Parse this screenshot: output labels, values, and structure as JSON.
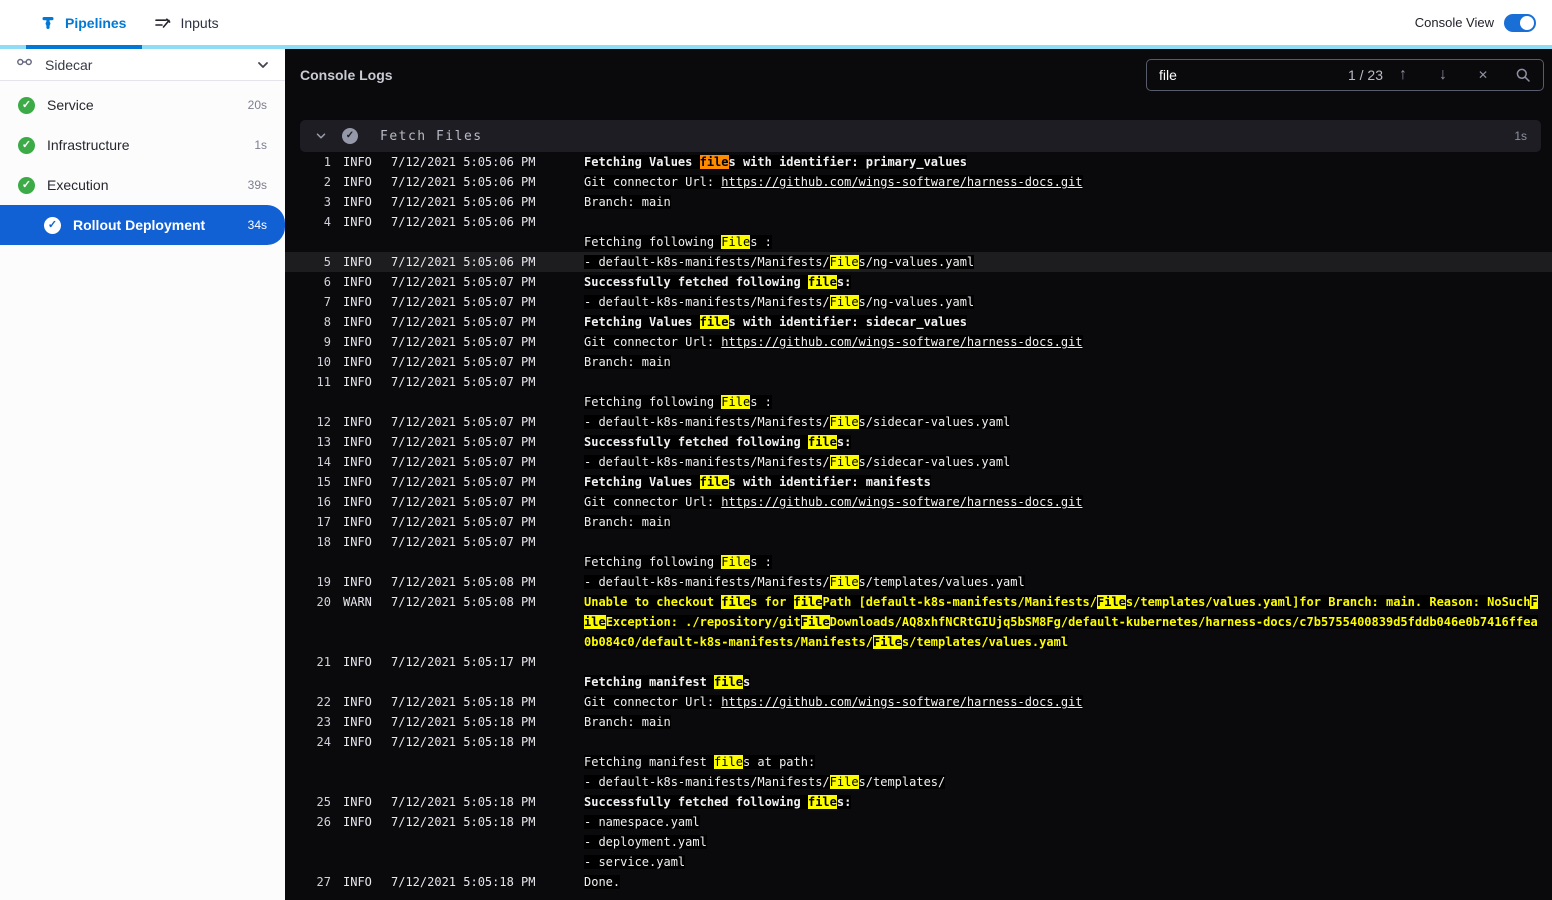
{
  "header": {
    "tabs": [
      {
        "label": "Pipelines",
        "active": true
      },
      {
        "label": "Inputs",
        "active": false
      }
    ],
    "console_view_label": "Console View",
    "console_view_on": true
  },
  "colors": {
    "accent_blue": "#0278d5",
    "selected_blue": "#1160d4",
    "underbar_cyan": "#8edcf5",
    "success_green": "#3cab47",
    "console_bg": "#0a0a0c",
    "match_current": "#ff8a00",
    "match_other": "#fcfc00",
    "warn_text": "#fcfc00"
  },
  "sidebar": {
    "title": "Sidecar",
    "items": [
      {
        "label": "Service",
        "duration": "20s",
        "status": "success",
        "selected": false
      },
      {
        "label": "Infrastructure",
        "duration": "1s",
        "status": "success",
        "selected": false
      },
      {
        "label": "Execution",
        "duration": "39s",
        "status": "success",
        "selected": false
      },
      {
        "label": "Rollout Deployment",
        "duration": "34s",
        "status": "success",
        "selected": true
      }
    ]
  },
  "console": {
    "title": "Console Logs",
    "search": {
      "value": "file",
      "count": "1 / 23"
    },
    "section": {
      "title": "Fetch Files",
      "duration": "1s"
    },
    "rows": [
      {
        "n": "1",
        "lv": "INFO",
        "t": "7/12/2021 5:05:06 PM",
        "b": 1,
        "s": [
          {
            "t": "Fetching Values "
          },
          {
            "t": "file",
            "h": "o"
          },
          {
            "t": "s with identifier: primary_values"
          }
        ]
      },
      {
        "n": "2",
        "lv": "INFO",
        "t": "7/12/2021 5:05:06 PM",
        "s": [
          {
            "t": "Git connector Url: "
          },
          {
            "t": "https://github.com/wings-software/harness-docs.git",
            "u": 1
          }
        ]
      },
      {
        "n": "3",
        "lv": "INFO",
        "t": "7/12/2021 5:05:06 PM",
        "s": [
          {
            "t": "Branch: main"
          }
        ]
      },
      {
        "n": "4",
        "lv": "INFO",
        "t": "7/12/2021 5:05:06 PM",
        "s": []
      },
      {
        "n": "",
        "lv": "",
        "t": "",
        "s": [
          {
            "t": "Fetching following "
          },
          {
            "t": "File",
            "h": "y"
          },
          {
            "t": "s :"
          }
        ]
      },
      {
        "n": "5",
        "lv": "INFO",
        "t": "7/12/2021 5:05:06 PM",
        "hl": 1,
        "s": [
          {
            "t": "- default-k8s-manifests/Manifests/"
          },
          {
            "t": "File",
            "h": "y"
          },
          {
            "t": "s/ng-values.yaml"
          }
        ]
      },
      {
        "n": "6",
        "lv": "INFO",
        "t": "7/12/2021 5:05:07 PM",
        "b": 1,
        "s": [
          {
            "t": "Successfully fetched following "
          },
          {
            "t": "file",
            "h": "y"
          },
          {
            "t": "s:"
          }
        ]
      },
      {
        "n": "7",
        "lv": "INFO",
        "t": "7/12/2021 5:05:07 PM",
        "s": [
          {
            "t": "- default-k8s-manifests/Manifests/"
          },
          {
            "t": "File",
            "h": "y"
          },
          {
            "t": "s/ng-values.yaml"
          }
        ]
      },
      {
        "n": "8",
        "lv": "INFO",
        "t": "7/12/2021 5:05:07 PM",
        "b": 1,
        "s": [
          {
            "t": "Fetching Values "
          },
          {
            "t": "file",
            "h": "y"
          },
          {
            "t": "s with identifier: sidecar_values"
          }
        ]
      },
      {
        "n": "9",
        "lv": "INFO",
        "t": "7/12/2021 5:05:07 PM",
        "s": [
          {
            "t": "Git connector Url: "
          },
          {
            "t": "https://github.com/wings-software/harness-docs.git",
            "u": 1
          }
        ]
      },
      {
        "n": "10",
        "lv": "INFO",
        "t": "7/12/2021 5:05:07 PM",
        "s": [
          {
            "t": "Branch: main"
          }
        ]
      },
      {
        "n": "11",
        "lv": "INFO",
        "t": "7/12/2021 5:05:07 PM",
        "s": []
      },
      {
        "n": "",
        "lv": "",
        "t": "",
        "s": [
          {
            "t": "Fetching following "
          },
          {
            "t": "File",
            "h": "y"
          },
          {
            "t": "s :"
          }
        ]
      },
      {
        "n": "12",
        "lv": "INFO",
        "t": "7/12/2021 5:05:07 PM",
        "s": [
          {
            "t": "- default-k8s-manifests/Manifests/"
          },
          {
            "t": "File",
            "h": "y"
          },
          {
            "t": "s/sidecar-values.yaml"
          }
        ]
      },
      {
        "n": "13",
        "lv": "INFO",
        "t": "7/12/2021 5:05:07 PM",
        "b": 1,
        "s": [
          {
            "t": "Successfully fetched following "
          },
          {
            "t": "file",
            "h": "y"
          },
          {
            "t": "s:"
          }
        ]
      },
      {
        "n": "14",
        "lv": "INFO",
        "t": "7/12/2021 5:05:07 PM",
        "s": [
          {
            "t": "- default-k8s-manifests/Manifests/"
          },
          {
            "t": "File",
            "h": "y"
          },
          {
            "t": "s/sidecar-values.yaml"
          }
        ]
      },
      {
        "n": "15",
        "lv": "INFO",
        "t": "7/12/2021 5:05:07 PM",
        "b": 1,
        "s": [
          {
            "t": "Fetching Values "
          },
          {
            "t": "file",
            "h": "y"
          },
          {
            "t": "s with identifier: manifests"
          }
        ]
      },
      {
        "n": "16",
        "lv": "INFO",
        "t": "7/12/2021 5:05:07 PM",
        "s": [
          {
            "t": "Git connector Url: "
          },
          {
            "t": "https://github.com/wings-software/harness-docs.git",
            "u": 1
          }
        ]
      },
      {
        "n": "17",
        "lv": "INFO",
        "t": "7/12/2021 5:05:07 PM",
        "s": [
          {
            "t": "Branch: main"
          }
        ]
      },
      {
        "n": "18",
        "lv": "INFO",
        "t": "7/12/2021 5:05:07 PM",
        "s": []
      },
      {
        "n": "",
        "lv": "",
        "t": "",
        "s": [
          {
            "t": "Fetching following "
          },
          {
            "t": "File",
            "h": "y"
          },
          {
            "t": "s :"
          }
        ]
      },
      {
        "n": "19",
        "lv": "INFO",
        "t": "7/12/2021 5:05:08 PM",
        "s": [
          {
            "t": "- default-k8s-manifests/Manifests/"
          },
          {
            "t": "File",
            "h": "y"
          },
          {
            "t": "s/templates/values.yaml"
          }
        ]
      },
      {
        "n": "20",
        "lv": "WARN",
        "t": "7/12/2021 5:05:08 PM",
        "w": 1,
        "wrap": 1,
        "s": [
          {
            "t": "Unable to checkout "
          },
          {
            "t": "file",
            "h": "y"
          },
          {
            "t": "s for "
          },
          {
            "t": "file",
            "h": "y"
          },
          {
            "t": "Path [default-k8s-manifests/Manifests/"
          },
          {
            "t": "File",
            "h": "y"
          },
          {
            "t": "s/templates/values.yaml]for Branch: main. Reason: NoSuch"
          },
          {
            "t": "File",
            "h": "y"
          },
          {
            "t": "Exception: ./repository/git"
          },
          {
            "t": "File",
            "h": "y"
          },
          {
            "t": "Downloads/AQ8xhfNCRtGIUjq5bSM8Fg/default-kubernetes/harness-docs/c7b5755400839d5fddb046e0b7416ffea0b084c0/default-k8s-manifests/Manifests/"
          },
          {
            "t": "File",
            "h": "y"
          },
          {
            "t": "s/templates/values.yaml"
          }
        ]
      },
      {
        "n": "21",
        "lv": "INFO",
        "t": "7/12/2021 5:05:17 PM",
        "s": []
      },
      {
        "n": "",
        "lv": "",
        "t": "",
        "b": 1,
        "s": [
          {
            "t": "Fetching manifest "
          },
          {
            "t": "file",
            "h": "y"
          },
          {
            "t": "s"
          }
        ]
      },
      {
        "n": "22",
        "lv": "INFO",
        "t": "7/12/2021 5:05:18 PM",
        "s": [
          {
            "t": "Git connector Url: "
          },
          {
            "t": "https://github.com/wings-software/harness-docs.git",
            "u": 1
          }
        ]
      },
      {
        "n": "23",
        "lv": "INFO",
        "t": "7/12/2021 5:05:18 PM",
        "s": [
          {
            "t": "Branch: main"
          }
        ]
      },
      {
        "n": "24",
        "lv": "INFO",
        "t": "7/12/2021 5:05:18 PM",
        "s": []
      },
      {
        "n": "",
        "lv": "",
        "t": "",
        "s": [
          {
            "t": "Fetching manifest "
          },
          {
            "t": "file",
            "h": "y"
          },
          {
            "t": "s at path:"
          }
        ]
      },
      {
        "n": "",
        "lv": "",
        "t": "",
        "s": [
          {
            "t": "- default-k8s-manifests/Manifests/"
          },
          {
            "t": "File",
            "h": "y"
          },
          {
            "t": "s/templates/"
          }
        ]
      },
      {
        "n": "25",
        "lv": "INFO",
        "t": "7/12/2021 5:05:18 PM",
        "b": 1,
        "s": [
          {
            "t": "Successfully fetched following "
          },
          {
            "t": "file",
            "h": "y"
          },
          {
            "t": "s:"
          }
        ]
      },
      {
        "n": "26",
        "lv": "INFO",
        "t": "7/12/2021 5:05:18 PM",
        "s": [
          {
            "t": "- namespace.yaml"
          }
        ]
      },
      {
        "n": "",
        "lv": "",
        "t": "",
        "s": [
          {
            "t": "- deployment.yaml"
          }
        ]
      },
      {
        "n": "",
        "lv": "",
        "t": "",
        "s": [
          {
            "t": "- service.yaml"
          }
        ]
      },
      {
        "n": "27",
        "lv": "INFO",
        "t": "7/12/2021 5:05:18 PM",
        "s": [
          {
            "t": "Done."
          }
        ]
      }
    ]
  }
}
